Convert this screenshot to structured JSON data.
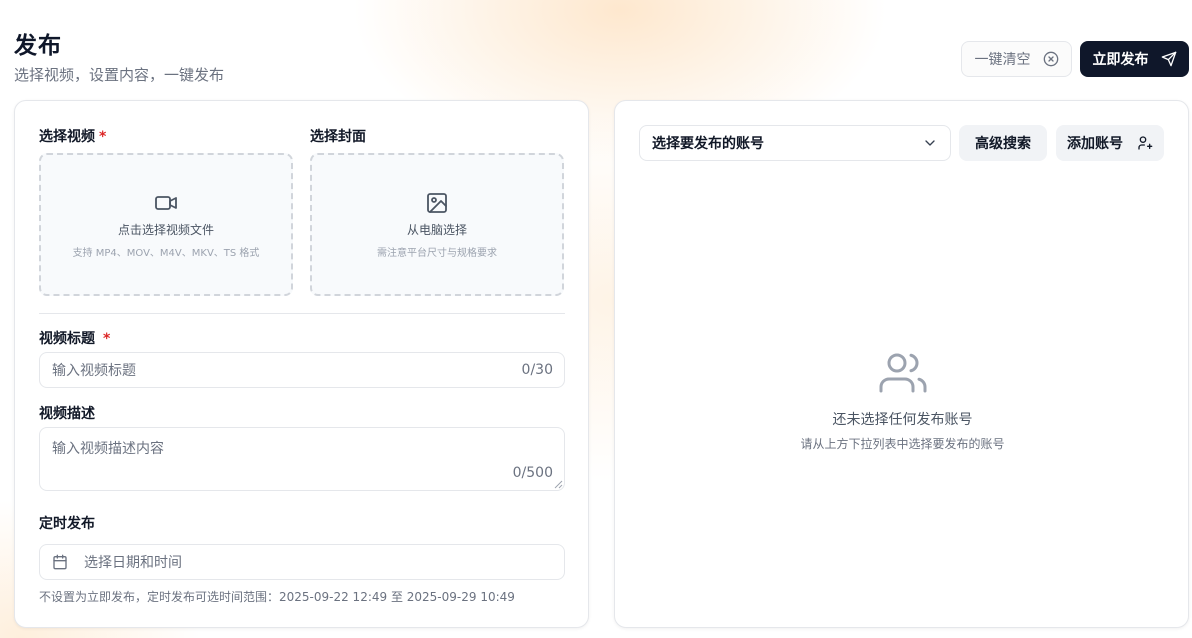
{
  "header": {
    "title": "发布",
    "subtitle": "选择视频，设置内容，一键发布"
  },
  "toolbar": {
    "clear_label": "一键清空",
    "publish_label": "立即发布"
  },
  "left_panel": {
    "video_label": "选择视频",
    "required_mark": "*",
    "cover_label": "选择封面",
    "video_upload": {
      "title": "点击选择视频文件",
      "hint": "支持 MP4、MOV、M4V、MKV、TS 格式"
    },
    "cover_upload": {
      "title": "从电脑选择",
      "hint": "需注意平台尺寸与规格要求"
    },
    "title_label": "视频标题",
    "title_placeholder": "输入视频标题",
    "title_counter": "0/30",
    "desc_label": "视频描述",
    "desc_placeholder": "输入视频描述内容",
    "desc_counter": "0/500",
    "schedule_label": "定时发布",
    "schedule_placeholder": "选择日期和时间",
    "schedule_hint": "不设置为立即发布，定时发布可选时间范围：2025-09-22 12:49 至 2025-09-29 10:49"
  },
  "right_panel": {
    "account_select": "选择要发布的账号",
    "advanced_search_label": "高级搜索",
    "add_account_label": "添加账号",
    "empty_title": "还未选择任何发布账号",
    "empty_hint": "请从上方下拉列表中选择要发布的账号"
  },
  "icons": {
    "clear": "x-circle-icon",
    "publish": "send-icon",
    "video": "video-camera-icon",
    "cover": "image-icon",
    "calendar": "calendar-icon",
    "dropdown": "chevron-down-icon",
    "add_account": "user-plus-icon",
    "empty": "users-icon"
  },
  "colors": {
    "primary": "#0f172a",
    "required": "#dc2626",
    "muted": "#6b7280"
  }
}
